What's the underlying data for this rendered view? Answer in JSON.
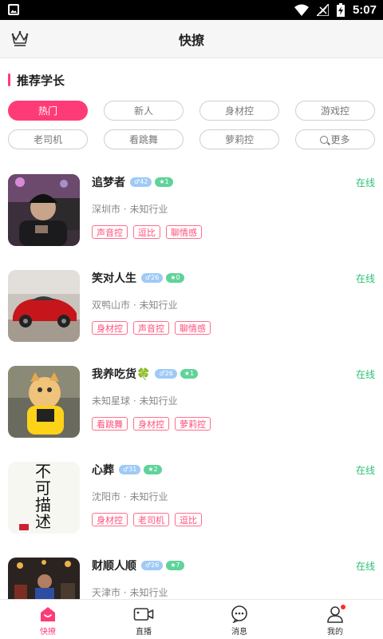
{
  "status": {
    "time": "5:07"
  },
  "header": {
    "title": "快撩"
  },
  "section": {
    "title": "推荐学长"
  },
  "tags": [
    {
      "label": "热门",
      "active": true
    },
    {
      "label": "新人"
    },
    {
      "label": "身材控"
    },
    {
      "label": "游戏控"
    },
    {
      "label": "老司机"
    },
    {
      "label": "看跳舞"
    },
    {
      "label": "萝莉控"
    },
    {
      "label": "更多",
      "icon": "search-icon"
    }
  ],
  "users": [
    {
      "name": "追梦者",
      "age": "♂42",
      "level": "★1",
      "status": "在线",
      "location": "深圳市 · 未知行业",
      "tags": [
        "声音控",
        "逗比",
        "聊情感"
      ]
    },
    {
      "name": "笑对人生",
      "age": "♂26",
      "level": "★0",
      "status": "在线",
      "location": "双鸭山市 · 未知行业",
      "tags": [
        "身材控",
        "声音控",
        "聊情感"
      ]
    },
    {
      "name": "我养吃货🍀",
      "age": "♂26",
      "level": "★1",
      "status": "在线",
      "location": "未知星球 · 未知行业",
      "tags": [
        "看跳舞",
        "身材控",
        "萝莉控"
      ]
    },
    {
      "name": "心葬",
      "age": "♂31",
      "level": "★2",
      "status": "在线",
      "location": "沈阳市 · 未知行业",
      "tags": [
        "身材控",
        "老司机",
        "逗比"
      ]
    },
    {
      "name": "财顺人顺",
      "age": "♂26",
      "level": "★7",
      "status": "在线",
      "location": "天津市 · 未知行业",
      "tags": []
    }
  ],
  "avatar4_text": "不可描述",
  "nav": [
    {
      "label": "快撩",
      "icon": "home-icon",
      "active": true
    },
    {
      "label": "直播",
      "icon": "video-camera-icon"
    },
    {
      "label": "消息",
      "icon": "message-icon"
    },
    {
      "label": "我的",
      "icon": "profile-icon"
    }
  ],
  "colors": {
    "accent": "#ff3b77",
    "online": "#2bc177",
    "age_badge": "#9fcaf6",
    "level_badge": "#5fd39a"
  }
}
